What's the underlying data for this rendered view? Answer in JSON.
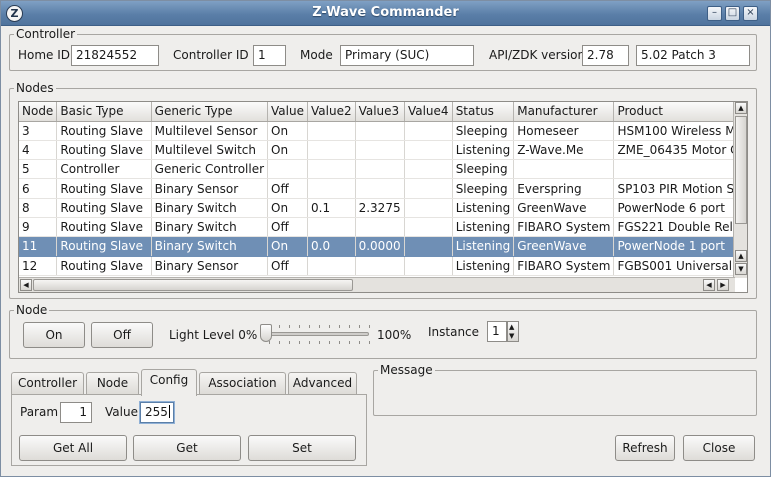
{
  "window": {
    "title": "Z-Wave Commander"
  },
  "controller": {
    "legend": "Controller",
    "home_id_label": "Home ID",
    "home_id": "21824552",
    "controller_id_label": "Controller ID",
    "controller_id": "1",
    "mode_label": "Mode",
    "mode": "Primary (SUC)",
    "api_label": "API/ZDK version",
    "api_version": "2.78",
    "zdk_version": "5.02 Patch 3"
  },
  "nodes": {
    "legend": "Nodes",
    "columns": [
      "Node",
      "Basic Type",
      "Generic Type",
      "Value",
      "Value2",
      "Value3",
      "Value4",
      "Status",
      "Manufacturer",
      "Product"
    ],
    "rows": [
      [
        "3",
        "Routing Slave",
        "Multilevel Sensor",
        "On",
        "",
        "",
        "",
        "Sleeping",
        "Homeseer",
        "HSM100 Wireless M"
      ],
      [
        "4",
        "Routing Slave",
        "Multilevel Switch",
        "On",
        "",
        "",
        "",
        "Listening",
        "Z-Wave.Me",
        "ZME_06435 Motor C"
      ],
      [
        "5",
        "Controller",
        "Generic Controller",
        "",
        "",
        "",
        "",
        "Sleeping",
        "",
        ""
      ],
      [
        "6",
        "Routing Slave",
        "Binary Sensor",
        "Off",
        "",
        "",
        "",
        "Sleeping",
        "Everspring",
        "SP103 PIR Motion S"
      ],
      [
        "8",
        "Routing Slave",
        "Binary Switch",
        "On",
        "0.1",
        "2.3275",
        "",
        "Listening",
        "GreenWave",
        "PowerNode 6 port"
      ],
      [
        "9",
        "Routing Slave",
        "Binary Switch",
        "Off",
        "",
        "",
        "",
        "Listening",
        "FIBARO System",
        "FGS221 Double Rel"
      ],
      [
        "11",
        "Routing Slave",
        "Binary Switch",
        "On",
        "0.0",
        "0.0000",
        "",
        "Listening",
        "GreenWave",
        "PowerNode 1 port"
      ],
      [
        "12",
        "Routing Slave",
        "Binary Sensor",
        "Off",
        "",
        "",
        "",
        "Listening",
        "FIBARO System",
        "FGBS001 Universal"
      ]
    ],
    "selected_row": 6
  },
  "node": {
    "legend": "Node",
    "on_label": "On",
    "off_label": "Off",
    "light_level_label": "Light Level 0%",
    "light_level_max_label": "100%",
    "light_level": 0,
    "instance_label": "Instance",
    "instance": "1"
  },
  "tabs": {
    "items": [
      "Controller",
      "Node",
      "Config",
      "Association",
      "Advanced"
    ],
    "active": "Config"
  },
  "config": {
    "param_label": "Param",
    "param": "1",
    "value_label": "Value",
    "value": "255",
    "get_all_label": "Get All",
    "get_label": "Get",
    "set_label": "Set"
  },
  "message": {
    "legend": "Message",
    "text": ""
  },
  "footer": {
    "refresh_label": "Refresh",
    "close_label": "Close"
  },
  "colors": {
    "titlebar": "#5b7fa8",
    "selection": "#6f8fb5"
  }
}
